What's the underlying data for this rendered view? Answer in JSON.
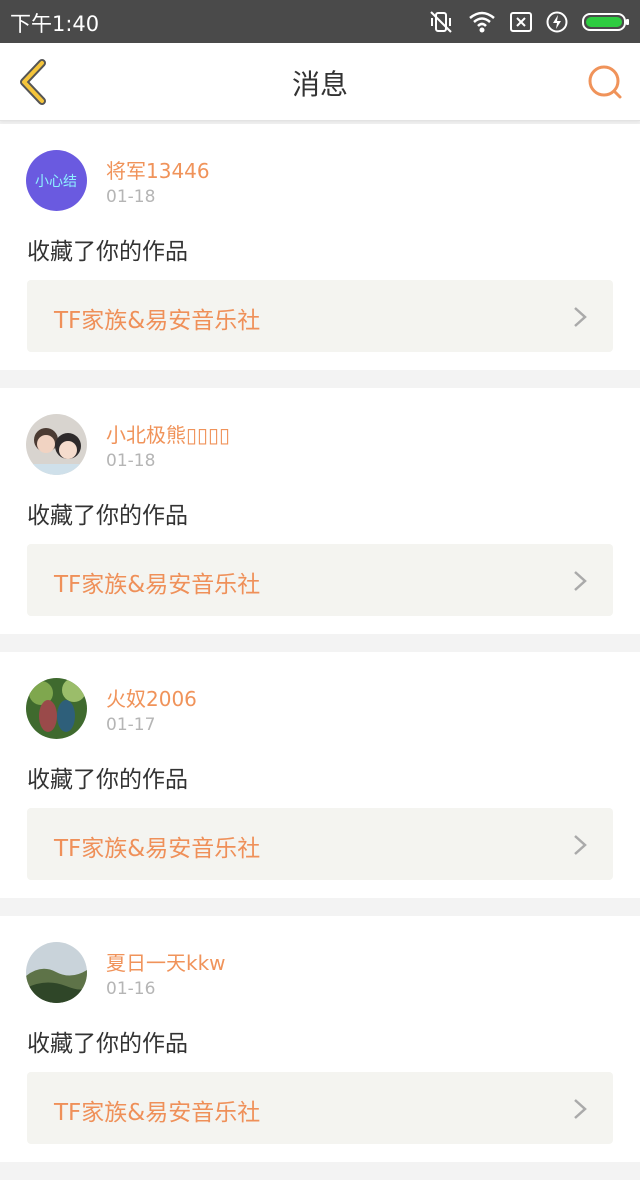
{
  "status_bar": {
    "time": "下午1:40",
    "icons": [
      "vibrate-off-icon",
      "wifi-icon",
      "no-sim-icon",
      "charging-icon",
      "battery-icon"
    ],
    "battery_color": "#2ecc40"
  },
  "header": {
    "title": "消息",
    "back_icon": "chevron-left-icon",
    "search_icon": "search-icon",
    "accent_color": "#f0935a"
  },
  "messages": [
    {
      "username": "将军13446",
      "date": "01-18",
      "action": "收藏了你的作品",
      "work_title": "TF家族&易安音乐社",
      "avatar_text": "小心结"
    },
    {
      "username": "小北极熊▯▯▯▯",
      "date": "01-18",
      "action": "收藏了你的作品",
      "work_title": "TF家族&易安音乐社"
    },
    {
      "username": "火奴2006",
      "date": "01-17",
      "action": "收藏了你的作品",
      "work_title": "TF家族&易安音乐社"
    },
    {
      "username": "夏日一天kkw",
      "date": "01-16",
      "action": "收藏了你的作品",
      "work_title": "TF家族&易安音乐社"
    }
  ]
}
